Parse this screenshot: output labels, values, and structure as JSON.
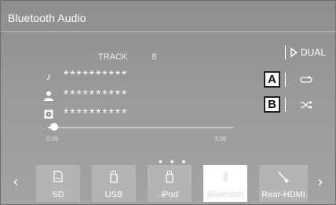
{
  "header": {
    "title": "Bluetooth Audio"
  },
  "dual_button": {
    "label": "DUAL"
  },
  "track": {
    "label": "TRACK",
    "number": "8"
  },
  "meta": {
    "song": "**********",
    "artist": "**********",
    "album": "**********"
  },
  "callouts": {
    "a": "A",
    "b": "B"
  },
  "progress": {
    "elapsed": "0:06",
    "total": "3:08",
    "fraction": 0.032
  },
  "pager": {
    "dots": "• • •"
  },
  "nav": {
    "prev": "‹",
    "next": "›"
  },
  "sources": [
    {
      "label": "SD",
      "icon": "sd-card-icon",
      "active": false
    },
    {
      "label": "USB",
      "icon": "usb-icon",
      "active": false
    },
    {
      "label": "iPod",
      "icon": "ipod-icon",
      "active": false
    },
    {
      "label": "Bluetooth",
      "icon": "bluetooth-icon",
      "active": true
    },
    {
      "label": "Rear-HDMI",
      "icon": "hdmi-cable-icon",
      "active": false
    }
  ],
  "colors": {
    "screen": "#9a9a9a",
    "active_tab": "#ffffff",
    "tab": "#b4b4b4"
  }
}
